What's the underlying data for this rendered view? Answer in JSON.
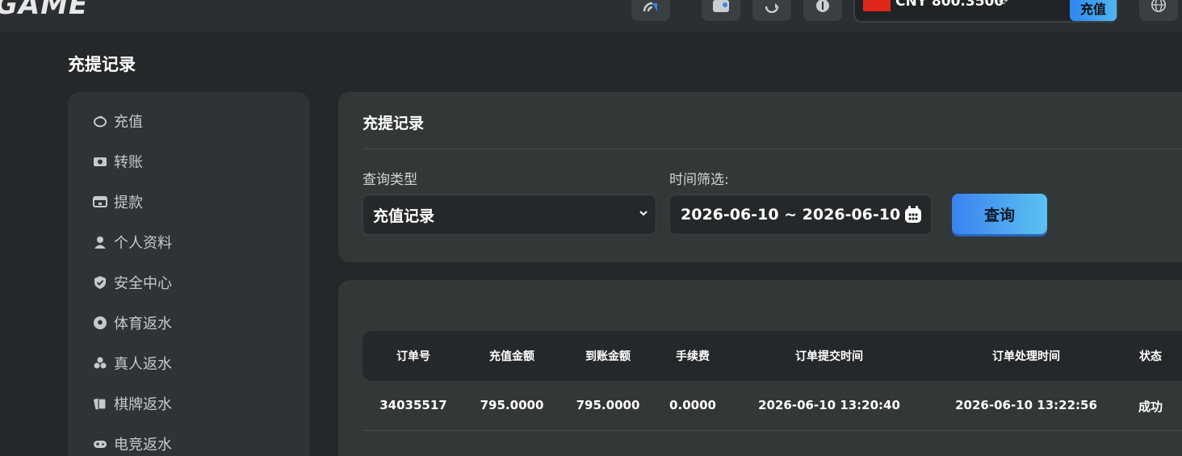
{
  "header": {
    "logo": "GAME",
    "balance": "CNY 800.3500",
    "refresh_glyph": "⟳",
    "deposit_label": "充值",
    "icons": [
      "signal-icon",
      "wallet-icon",
      "refresh-icon",
      "coin-icon",
      "globe-icon"
    ]
  },
  "page_title": "充提记录",
  "sidebar": {
    "items": [
      {
        "label": "充值",
        "icon": "piggy-bank-icon"
      },
      {
        "label": "转账",
        "icon": "transfer-icon"
      },
      {
        "label": "提款",
        "icon": "withdraw-icon"
      },
      {
        "label": "个人资料",
        "icon": "user-icon"
      },
      {
        "label": "安全中心",
        "icon": "shield-icon"
      },
      {
        "label": "体育返水",
        "icon": "soccer-ball-icon"
      },
      {
        "label": "真人返水",
        "icon": "live-casino-icon"
      },
      {
        "label": "棋牌返水",
        "icon": "cards-icon"
      },
      {
        "label": "电竞返水",
        "icon": "gamepad-icon"
      }
    ]
  },
  "filter": {
    "title": "充提记录",
    "type_label": "查询类型",
    "type_value": "充值记录",
    "time_label": "时间筛选:",
    "date_range": "2026-06-10 ~ 2026-06-10",
    "query_label": "查询"
  },
  "table": {
    "headers": [
      "订单号",
      "充值金额",
      "到账金额",
      "手续费",
      "订单提交时间",
      "订单处理时间",
      "状态"
    ],
    "rows": [
      [
        "34035517",
        "795.0000",
        "795.0000",
        "0.0000",
        "2026-06-10 13:20:40",
        "2026-06-10 13:22:56",
        "成功"
      ]
    ]
  },
  "colors": {
    "background": "#24282a",
    "panel": "#323738",
    "accent_start": "#3b82ef",
    "accent_end": "#5bc2f0"
  }
}
